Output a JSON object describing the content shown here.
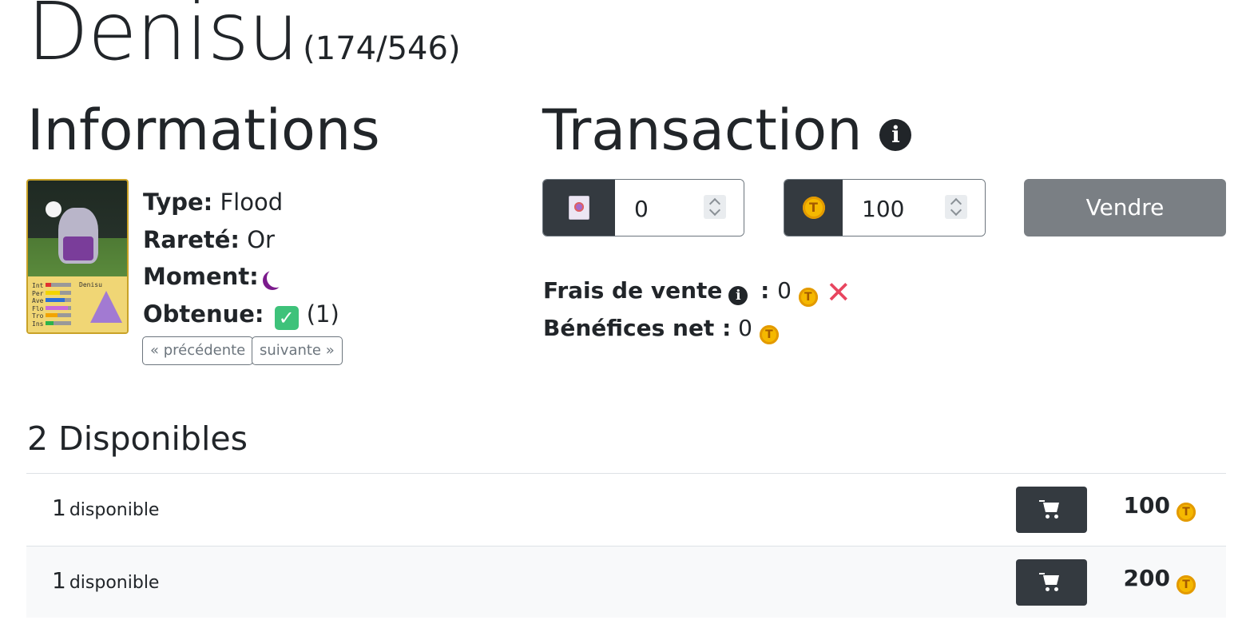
{
  "header": {
    "name": "Denisu",
    "count": "(174/546)"
  },
  "info": {
    "heading": "Informations",
    "type_label": "Type:",
    "type_value": "Flood",
    "rarity_label": "Rareté:",
    "rarity_value": "Or",
    "moment_label": "Moment:",
    "moment_icon": "crescent-moon-icon",
    "obtained_label": "Obtenue:",
    "obtained_icon": "check-mark-icon",
    "obtained_count": "(1)",
    "prev_label": "« précédente",
    "next_label": "suivante »",
    "card": {
      "name": "Denisu",
      "stats": [
        {
          "label": "Int",
          "level": 0.2,
          "color": "#e03030"
        },
        {
          "label": "Per",
          "level": 0.55,
          "color": "#f2d400"
        },
        {
          "label": "Ave",
          "level": 0.75,
          "color": "#2d6fd6"
        },
        {
          "label": "Flo",
          "level": 0.85,
          "color": "#c86bd8"
        },
        {
          "label": "Tro",
          "level": 0.45,
          "color": "#f2a400"
        },
        {
          "label": "Ins",
          "level": 0.3,
          "color": "#2db34a"
        }
      ]
    }
  },
  "transaction": {
    "heading": "Transaction",
    "quantity_value": "0",
    "price_value": "100",
    "sell_label": "Vendre",
    "fees_label": "Frais de vente",
    "fees_sep": " : ",
    "fees_value": "0",
    "profit_label": "Bénéfices net :",
    "profit_value": "0",
    "coin_letter": "T"
  },
  "available": {
    "heading": "2 Disponibles",
    "rows": [
      {
        "qty": "1",
        "unit": "disponible",
        "price": "100"
      },
      {
        "qty": "1",
        "unit": "disponible",
        "price": "200"
      }
    ]
  }
}
